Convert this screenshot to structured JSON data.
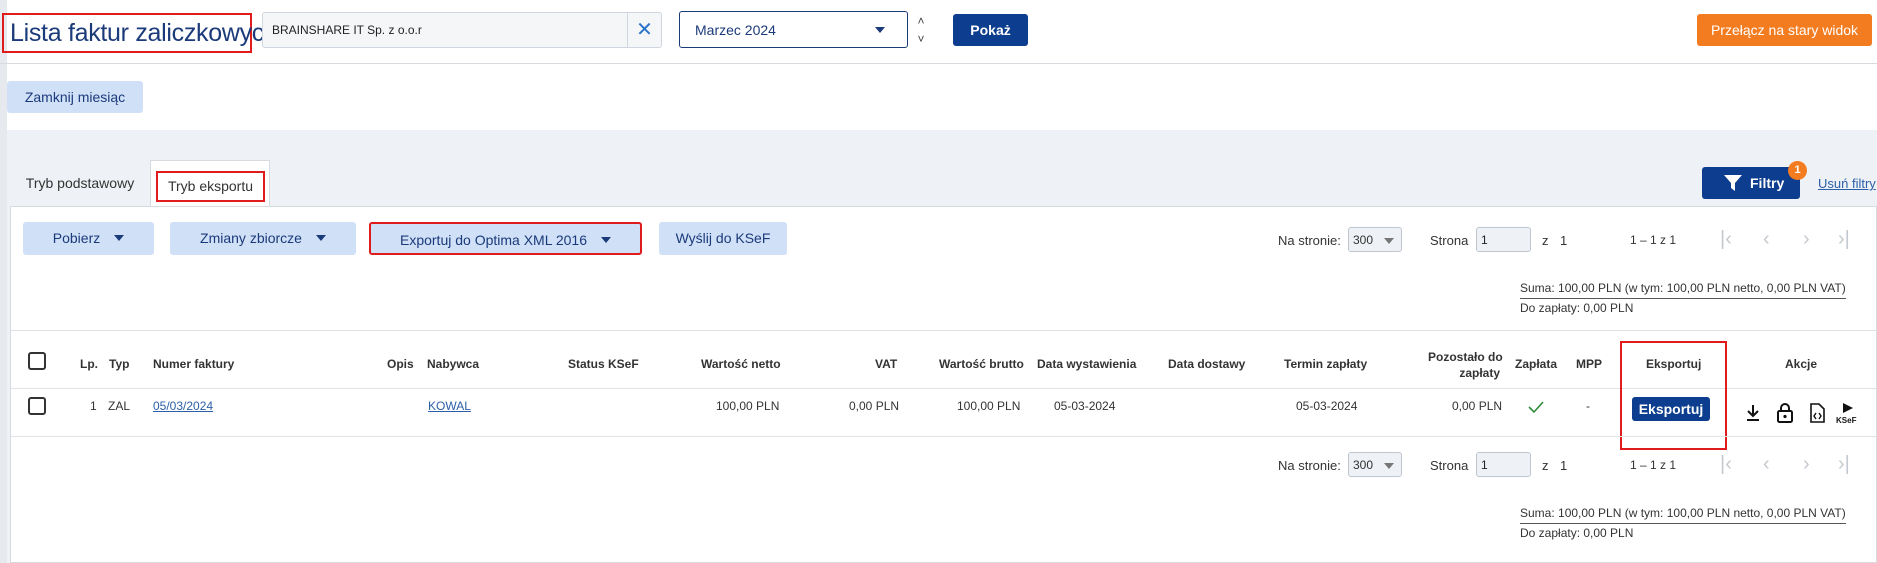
{
  "header": {
    "title": "Lista faktur zaliczkowych",
    "company_value": "BRAINSHARE IT Sp. z o.o.r",
    "month_value": "Marzec 2024",
    "show_label": "Pokaż",
    "old_view_label": "Przełącz na stary widok"
  },
  "close_month_label": "Zamknij miesiąc",
  "tabs": [
    {
      "label": "Tryb podstawowy",
      "active": false
    },
    {
      "label": "Tryb eksportu",
      "active": true
    }
  ],
  "filters": {
    "label": "Filtry",
    "badge": "1",
    "clear_label": "Usuń filtry"
  },
  "toolbar": {
    "download_label": "Pobierz",
    "bulk_label": "Zmiany zbiorcze",
    "export_label": "Exportuj do Optima XML 2016",
    "ksef_label": "Wyślij do KSeF"
  },
  "pagination": {
    "per_page_label": "Na stronie:",
    "per_page_value": "300",
    "page_label": "Strona",
    "page_value": "1",
    "of_label": "z",
    "total_pages": "1",
    "range": "1 – 1 z 1"
  },
  "summary": {
    "sum": "Suma: 100,00 PLN (w tym: 100,00 PLN netto, 0,00 PLN VAT)",
    "to_pay": "Do zapłaty: 0,00 PLN"
  },
  "table": {
    "columns": {
      "lp": "Lp.",
      "typ": "Typ",
      "numer": "Numer faktury",
      "opis": "Opis",
      "nabywca": "Nabywca",
      "status": "Status KSeF",
      "netto": "Wartość netto",
      "vat": "VAT",
      "brutto": "Wartość brutto",
      "data_wyst": "Data wystawienia",
      "data_dost": "Data dostawy",
      "termin": "Termin zapłaty",
      "pozostalo_1": "Pozostało do",
      "pozostalo_2": "zapłaty",
      "zaplata": "Zapłata",
      "mpp": "MPP",
      "eksportuj": "Eksportuj",
      "akcje": "Akcje"
    },
    "rows": [
      {
        "lp": "1",
        "typ": "ZAL",
        "numer": "05/03/2024",
        "opis": "",
        "nabywca": "KOWAL",
        "status": "",
        "netto": "100,00 PLN",
        "vat": "0,00 PLN",
        "brutto": "100,00 PLN",
        "data_wyst": "05-03-2024",
        "data_dost": "",
        "termin": "05-03-2024",
        "pozostalo": "0,00 PLN",
        "mpp": "-",
        "export_button": "Eksportuj",
        "ksef_icon_text": "KSeF"
      }
    ]
  },
  "colors": {
    "primary": "#0d3d8e",
    "accent_orange": "#f47c20",
    "light_button": "#cfe0f7",
    "highlight_red": "#e01b1b",
    "paid_check": "#2e8b3c"
  },
  "icons": [
    "clear-x-icon",
    "chevron-up-icon",
    "chevron-down-icon",
    "filter-funnel-icon",
    "first-page-icon",
    "prev-page-icon",
    "next-page-icon",
    "last-page-icon",
    "check-mark-icon",
    "download-icon",
    "lock-icon",
    "code-file-icon",
    "ksef-send-icon"
  ]
}
